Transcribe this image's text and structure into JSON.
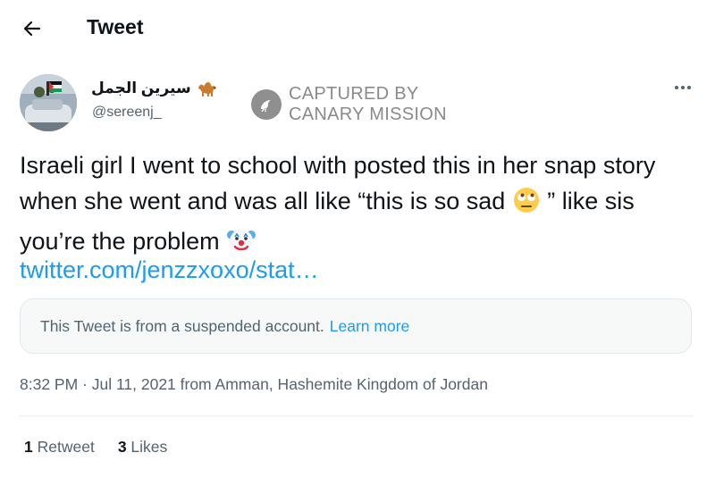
{
  "header": {
    "title": "Tweet",
    "back_icon": "arrow-left-icon"
  },
  "author": {
    "display_name": "سيرين الجمل",
    "name_emoji": "camel-emoji",
    "handle": "@sereenj_"
  },
  "watermark": {
    "line1": "CAPTURED BY",
    "line2": "CANARY MISSION"
  },
  "tweet": {
    "text_part1": "Israeli girl I went to school with posted this in her snap story when she went and was all like “this is so sad ",
    "text_part2": " ” like sis you’re the problem ",
    "link": "twitter.com/jenzzxoxo/stat…",
    "emoji1": "face-with-rolling-eyes-emoji",
    "emoji2": "clown-face-emoji"
  },
  "quote_notice": {
    "text": "This Tweet is from a suspended account.",
    "link": "Learn more"
  },
  "meta": {
    "time_source": "8:32 PM · Jul 11, 2021 from Amman, Hashemite Kingdom of Jordan"
  },
  "stats": {
    "retweets_count": "1",
    "retweets_label": "Retweet",
    "likes_count": "3",
    "likes_label": "Likes"
  },
  "colors": {
    "link": "#1d9bf0",
    "secondary_text": "#536471",
    "primary_text": "#0f1419"
  }
}
